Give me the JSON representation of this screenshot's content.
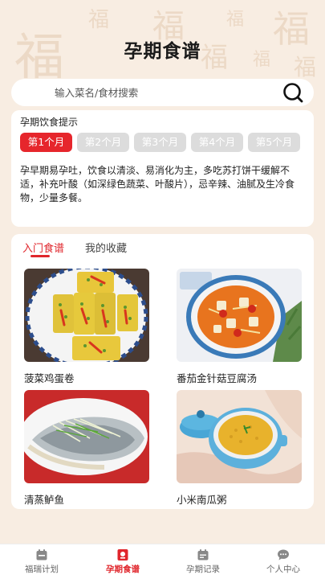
{
  "header": {
    "title": "孕期食谱"
  },
  "search": {
    "placeholder": "输入菜名/食材搜索"
  },
  "tips": {
    "title": "孕期饮食提示",
    "months": [
      "第1个月",
      "第2个月",
      "第3个月",
      "第4个月",
      "第5个月"
    ],
    "active_month_index": 0,
    "text": "孕早期易孕吐，饮食以清淡、易消化为主，多吃苏打饼干缓解不适，补充叶酸（如深绿色蔬菜、叶酸片），忌辛辣、油腻及生冷食物，少量多餐。"
  },
  "recipes": {
    "tabs": [
      "入门食谱",
      "我的收藏"
    ],
    "items": [
      {
        "name": "菠菜鸡蛋卷"
      },
      {
        "name": "番茄金针菇豆腐汤"
      },
      {
        "name": "清蒸鲈鱼"
      },
      {
        "name": "小米南瓜粥"
      }
    ]
  },
  "nav": {
    "items": [
      {
        "label": "福瑞计划",
        "icon": "calendar-icon"
      },
      {
        "label": "孕期食谱",
        "icon": "recipe-book-icon"
      },
      {
        "label": "孕期记录",
        "icon": "record-icon"
      },
      {
        "label": "个人中心",
        "icon": "chat-bubble-icon"
      }
    ],
    "active_index": 1
  },
  "colors": {
    "accent": "#e0262c",
    "background": "#f8ede2",
    "card": "#ffffff"
  }
}
